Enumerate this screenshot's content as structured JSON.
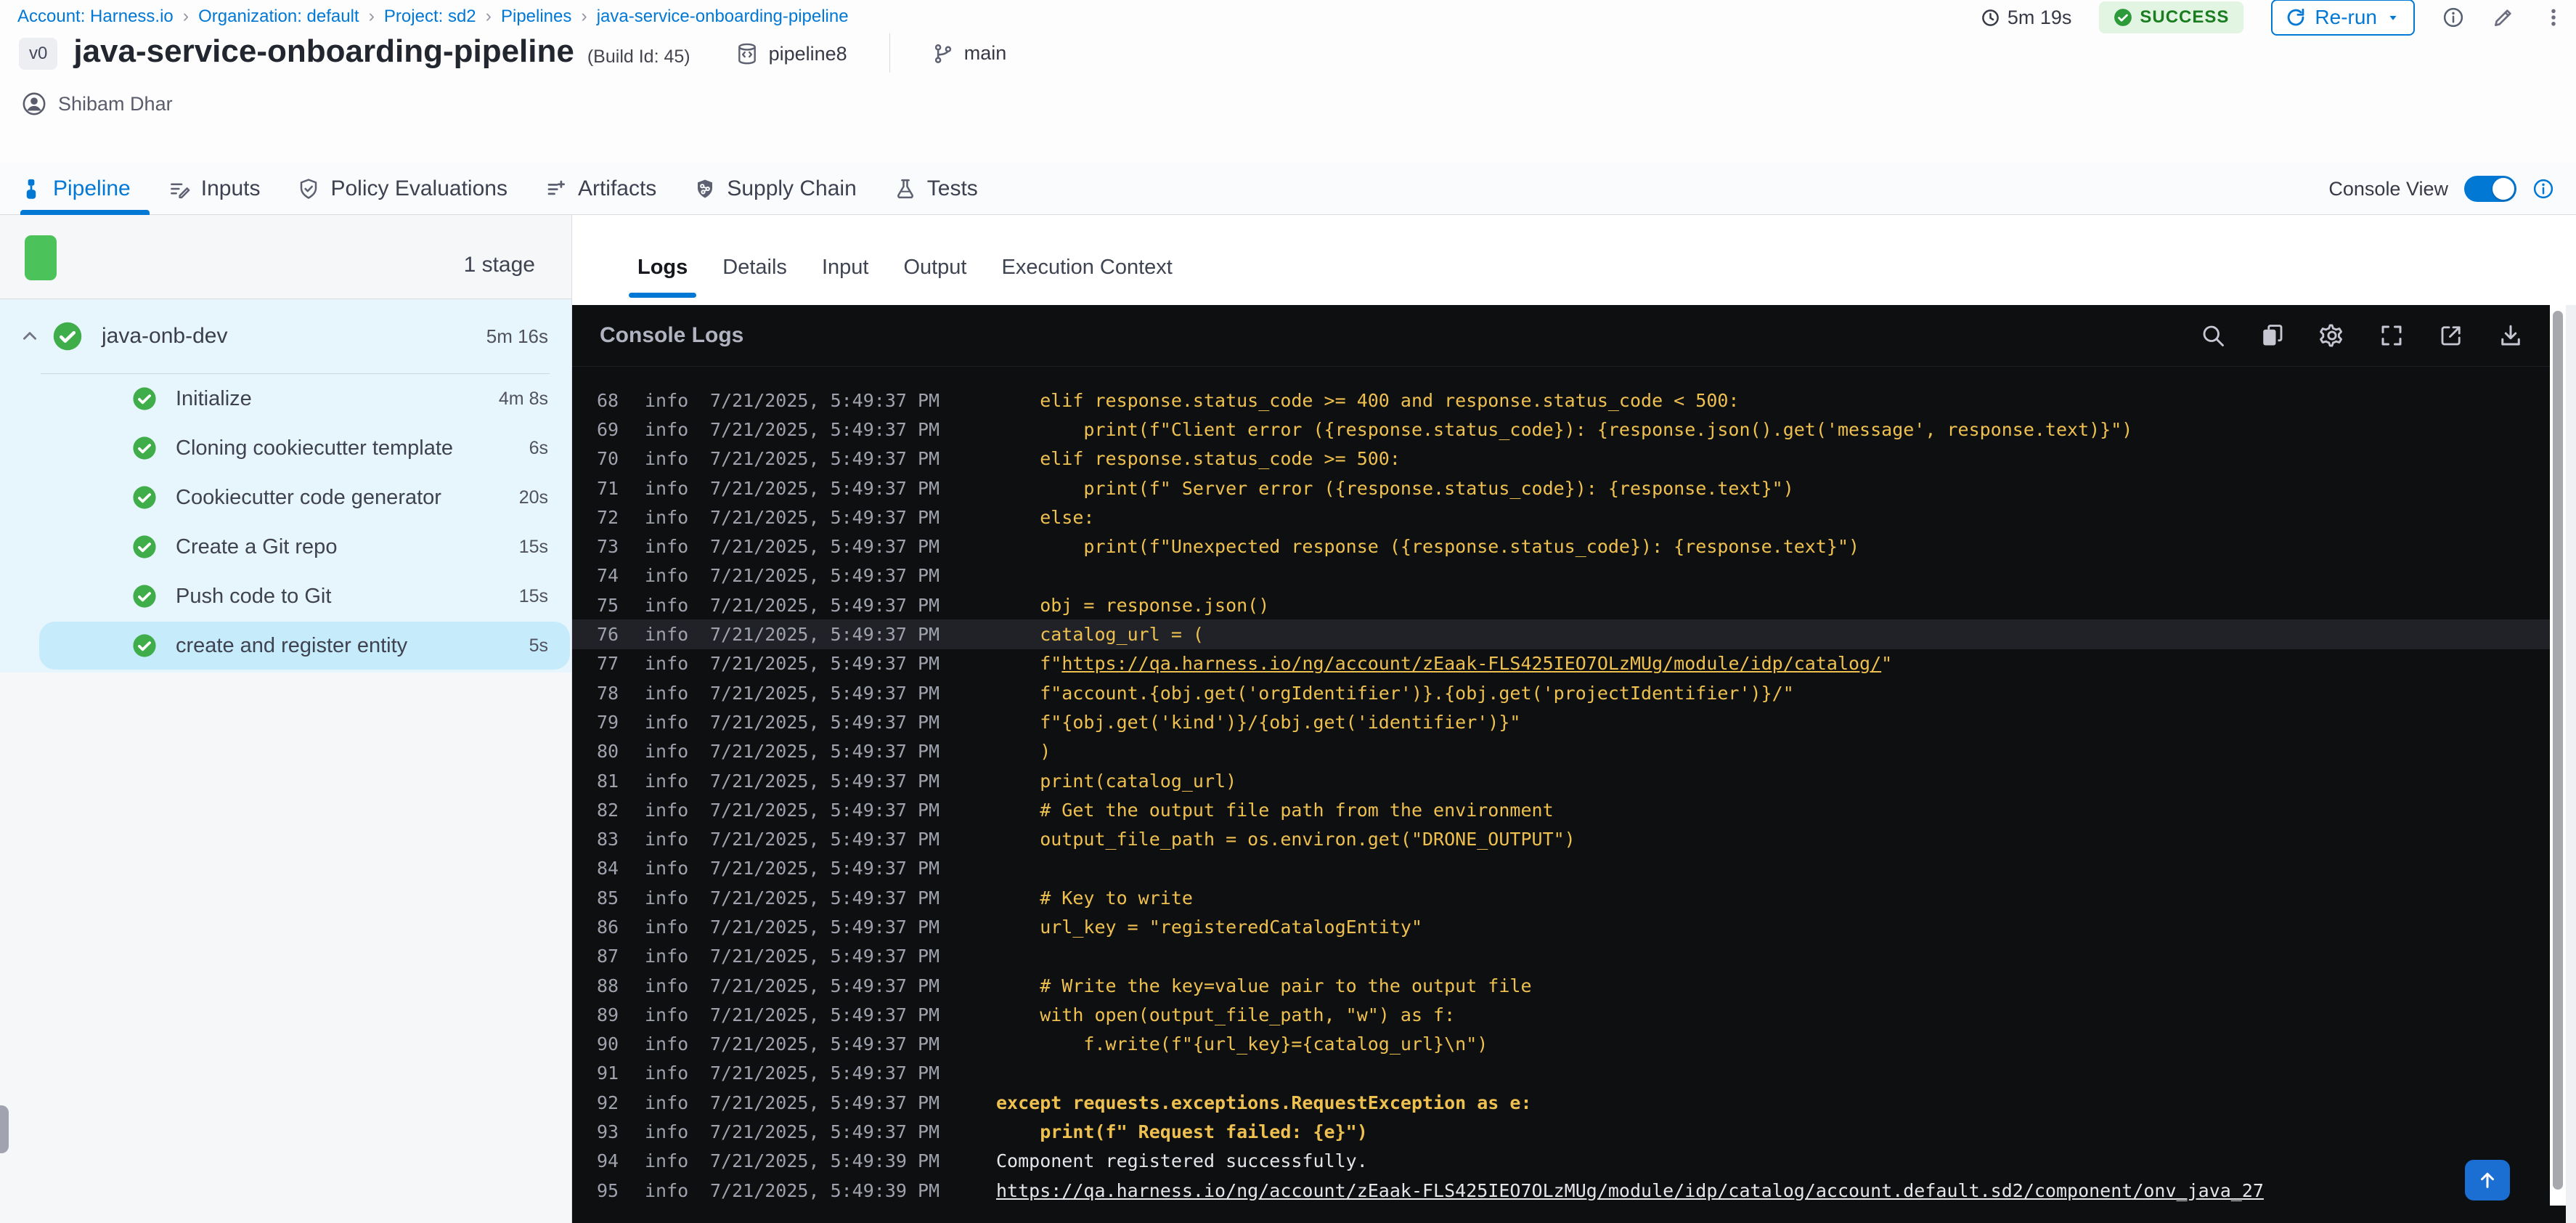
{
  "breadcrumb": {
    "separator": "›",
    "items": [
      {
        "label": "Account: Harness.io"
      },
      {
        "label": "Organization: default"
      },
      {
        "label": "Project: sd2"
      },
      {
        "label": "Pipelines"
      },
      {
        "label": "java-service-onboarding-pipeline"
      }
    ]
  },
  "header": {
    "duration": "5m 19s",
    "status": "SUCCESS",
    "rerun": "Re-run",
    "version_badge": "v0",
    "title": "java-service-onboarding-pipeline",
    "build_id": "(Build Id: 45)",
    "repo": "pipeline8",
    "branch": "main",
    "user": "Shibam Dhar"
  },
  "main_tabs": [
    {
      "label": "Pipeline",
      "active": true
    },
    {
      "label": "Inputs"
    },
    {
      "label": "Policy Evaluations"
    },
    {
      "label": "Artifacts"
    },
    {
      "label": "Supply Chain"
    },
    {
      "label": "Tests"
    }
  ],
  "console_view": {
    "label": "Console View",
    "enabled": true
  },
  "stage_panel": {
    "stage_count": "1 stage",
    "stage": {
      "name": "java-onb-dev",
      "duration": "5m 16s"
    },
    "steps": [
      {
        "name": "Initialize",
        "duration": "4m 8s"
      },
      {
        "name": "Cloning cookiecutter template",
        "duration": "6s"
      },
      {
        "name": "Cookiecutter code generator",
        "duration": "20s"
      },
      {
        "name": "Create a Git repo",
        "duration": "15s"
      },
      {
        "name": "Push code to Git",
        "duration": "15s"
      },
      {
        "name": "create and register entity",
        "duration": "5s",
        "state": "selected"
      }
    ]
  },
  "log_tabs": [
    {
      "label": "Logs",
      "active": true
    },
    {
      "label": "Details"
    },
    {
      "label": "Input"
    },
    {
      "label": "Output"
    },
    {
      "label": "Execution Context"
    }
  ],
  "console": {
    "title": "Console Logs",
    "icons": [
      "search-icon",
      "copy-icon",
      "settings-icon",
      "fullscreen-icon",
      "open-in-new-icon",
      "download-icon"
    ],
    "lines": [
      {
        "n": "68",
        "level": "info",
        "ts": "7/21/2025, 5:49:37 PM",
        "pre": "    elif response.status_code >= 400 and response.status_code < 500:",
        "cls": "code"
      },
      {
        "n": "69",
        "level": "info",
        "ts": "7/21/2025, 5:49:37 PM",
        "pre": "        print(f\"Client error ({response.status_code}): {response.json().get('message', response.text)}\")",
        "cls": "code"
      },
      {
        "n": "70",
        "level": "info",
        "ts": "7/21/2025, 5:49:37 PM",
        "pre": "    elif response.status_code >= 500:",
        "cls": "code"
      },
      {
        "n": "71",
        "level": "info",
        "ts": "7/21/2025, 5:49:37 PM",
        "pre": "        print(f\" Server error ({response.status_code}): {response.text}\")",
        "cls": "code"
      },
      {
        "n": "72",
        "level": "info",
        "ts": "7/21/2025, 5:49:37 PM",
        "pre": "    else:",
        "cls": "code"
      },
      {
        "n": "73",
        "level": "info",
        "ts": "7/21/2025, 5:49:37 PM",
        "pre": "        print(f\"Unexpected response ({response.status_code}): {response.text}\")",
        "cls": "code"
      },
      {
        "n": "74",
        "level": "info",
        "ts": "7/21/2025, 5:49:37 PM",
        "pre": "",
        "cls": "code"
      },
      {
        "n": "75",
        "level": "info",
        "ts": "7/21/2025, 5:49:37 PM",
        "pre": "    obj = response.json()",
        "cls": "code"
      },
      {
        "n": "76",
        "level": "info",
        "ts": "7/21/2025, 5:49:37 PM",
        "pre": "    catalog_url = (",
        "cls": "code",
        "hl": "hl"
      },
      {
        "n": "77",
        "level": "info",
        "ts": "7/21/2025, 5:49:37 PM",
        "pre": "    f\"",
        "link": "https://qa.harness.io/ng/account/zEaak-FLS425IEO7OLzMUg/module/idp/catalog/",
        "post": "\"",
        "cls": "code"
      },
      {
        "n": "78",
        "level": "info",
        "ts": "7/21/2025, 5:49:37 PM",
        "pre": "    f\"account.{obj.get('orgIdentifier')}.{obj.get('projectIdentifier')}/\"",
        "cls": "code"
      },
      {
        "n": "79",
        "level": "info",
        "ts": "7/21/2025, 5:49:37 PM",
        "pre": "    f\"{obj.get('kind')}/{obj.get('identifier')}\"",
        "cls": "code"
      },
      {
        "n": "80",
        "level": "info",
        "ts": "7/21/2025, 5:49:37 PM",
        "pre": "    )",
        "cls": "code"
      },
      {
        "n": "81",
        "level": "info",
        "ts": "7/21/2025, 5:49:37 PM",
        "pre": "    print(catalog_url)",
        "cls": "code"
      },
      {
        "n": "82",
        "level": "info",
        "ts": "7/21/2025, 5:49:37 PM",
        "pre": "    # Get the output file path from the environment",
        "cls": "code"
      },
      {
        "n": "83",
        "level": "info",
        "ts": "7/21/2025, 5:49:37 PM",
        "pre": "    output_file_path = os.environ.get(\"DRONE_OUTPUT\")",
        "cls": "code"
      },
      {
        "n": "84",
        "level": "info",
        "ts": "7/21/2025, 5:49:37 PM",
        "pre": "",
        "cls": "code"
      },
      {
        "n": "85",
        "level": "info",
        "ts": "7/21/2025, 5:49:37 PM",
        "pre": "    # Key to write",
        "cls": "code"
      },
      {
        "n": "86",
        "level": "info",
        "ts": "7/21/2025, 5:49:37 PM",
        "pre": "    url_key = \"registeredCatalogEntity\"",
        "cls": "code"
      },
      {
        "n": "87",
        "level": "info",
        "ts": "7/21/2025, 5:49:37 PM",
        "pre": "",
        "cls": "code"
      },
      {
        "n": "88",
        "level": "info",
        "ts": "7/21/2025, 5:49:37 PM",
        "pre": "    # Write the key=value pair to the output file",
        "cls": "code"
      },
      {
        "n": "89",
        "level": "info",
        "ts": "7/21/2025, 5:49:37 PM",
        "pre": "    with open(output_file_path, \"w\") as f:",
        "cls": "code"
      },
      {
        "n": "90",
        "level": "info",
        "ts": "7/21/2025, 5:49:37 PM",
        "pre": "        f.write(f\"{url_key}={catalog_url}\\n\")",
        "cls": "code"
      },
      {
        "n": "91",
        "level": "info",
        "ts": "7/21/2025, 5:49:37 PM",
        "pre": "",
        "cls": "code"
      },
      {
        "n": "92",
        "level": "info",
        "ts": "7/21/2025, 5:49:37 PM",
        "pre": "except requests.exceptions.RequestException as e:",
        "cls": "code bold"
      },
      {
        "n": "93",
        "level": "info",
        "ts": "7/21/2025, 5:49:37 PM",
        "pre": "    print(f\" Request failed: {e}\")",
        "cls": "code bold"
      },
      {
        "n": "94",
        "level": "info",
        "ts": "7/21/2025, 5:49:39 PM",
        "pre": "Component registered successfully.",
        "cls": "plain"
      },
      {
        "n": "95",
        "level": "info",
        "ts": "7/21/2025, 5:49:39 PM",
        "pre": "",
        "link": "https://qa.harness.io/ng/account/zEaak-FLS425IEO7OLzMUg/module/idp/catalog/account.default.sd2/component/onv_java_27",
        "post": "",
        "cls": "plain"
      }
    ]
  },
  "colors": {
    "accent_blue": "#0278d5",
    "success_green": "#3fae4a",
    "stage_square_green": "#4bc35a",
    "code_yellow": "#eec050",
    "selected_step_bg": "#c6ebfa",
    "stage_tree_bg": "#e7f5fc",
    "console_bg": "#0e0f11"
  }
}
